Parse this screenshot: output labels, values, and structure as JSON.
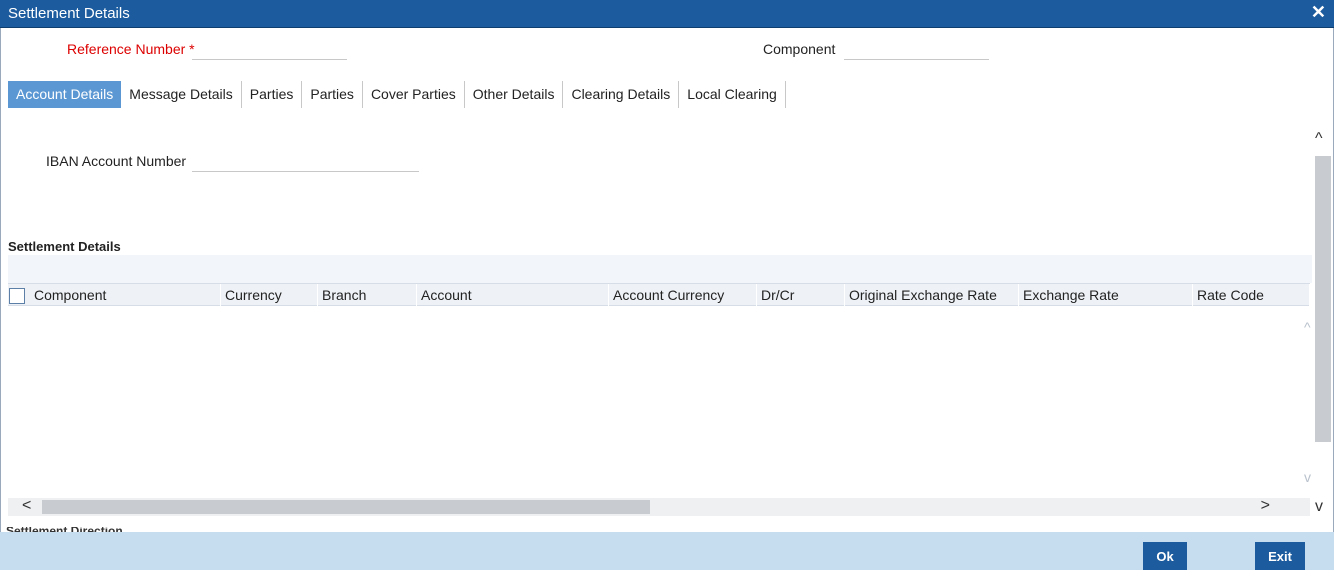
{
  "window": {
    "title": "Settlement Details",
    "close_glyph": "✕"
  },
  "header": {
    "reference_label": "Reference Number",
    "required_mark": "*",
    "reference_value": "",
    "component_label": "Component",
    "component_value": ""
  },
  "tabs": [
    {
      "label": "Account Details",
      "active": true
    },
    {
      "label": "Message Details"
    },
    {
      "label": "Parties"
    },
    {
      "label": "Parties"
    },
    {
      "label": "Cover Parties"
    },
    {
      "label": "Other Details"
    },
    {
      "label": "Clearing Details"
    },
    {
      "label": "Local Clearing"
    }
  ],
  "account": {
    "iban_label": "IBAN Account Number",
    "iban_value": ""
  },
  "settlement": {
    "title": "Settlement Details",
    "columns": [
      "Component",
      "Currency",
      "Branch",
      "Account",
      "Account Currency",
      "Dr/Cr",
      "Original Exchange Rate",
      "Exchange Rate",
      "Rate Code"
    ],
    "rows": []
  },
  "next_section_label": "Settlement Direction",
  "footer": {
    "ok_label": "Ok",
    "exit_label": "Exit"
  },
  "icons": {
    "chevron_up": "^",
    "chevron_down": "v",
    "arrow_left": "<",
    "arrow_right": ">"
  },
  "colors": {
    "titlebar": "#1c5c9e",
    "active_tab": "#5b97d3",
    "footer": "#c6dcef",
    "required": "#dd0000"
  }
}
